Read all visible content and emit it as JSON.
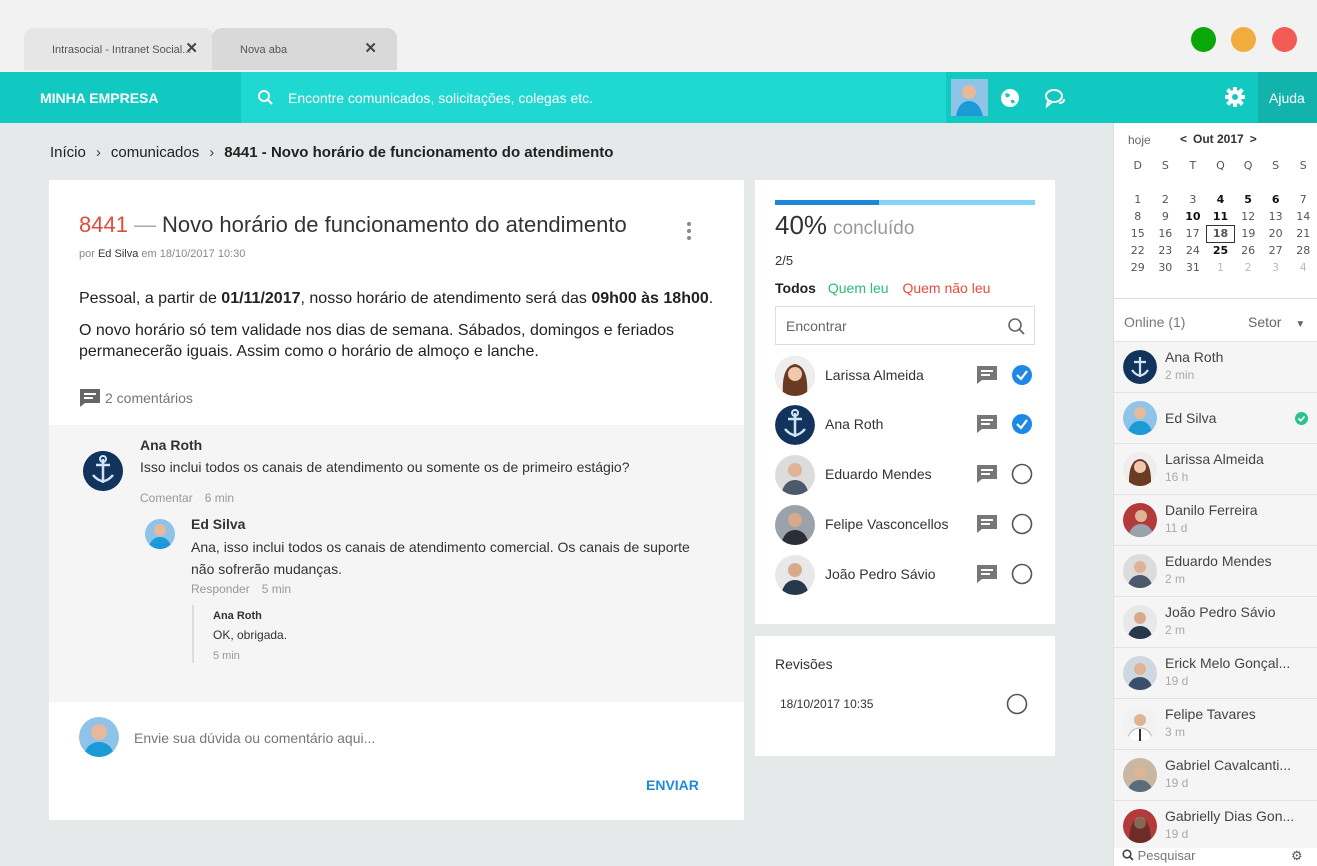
{
  "browser": {
    "tabs": [
      {
        "label": "Intrasocial - Intranet Social..."
      },
      {
        "label": "Nova aba"
      }
    ],
    "window_buttons": [
      "#0aa70a",
      "#f0ad3d",
      "#f25c54"
    ]
  },
  "topbar": {
    "brand": "MINHA EMPRESA",
    "search_placeholder": "Encontre comunicados, solicitações, colegas etc.",
    "help": "Ajuda",
    "accent": "#12c9c1"
  },
  "breadcrumb": {
    "home": "Início",
    "section": "comunicados",
    "current": "8441 - Novo horário de funcionamento do atendimento"
  },
  "post": {
    "number": "8441",
    "dash": "—",
    "title": "Novo horário de funcionamento do atendimento",
    "by_prefix": "por",
    "author": "Ed Silva",
    "date_text": "em 18/10/2017 10:30",
    "p1_a": "Pessoal, a partir de ",
    "p1_date": "01/11/2017",
    "p1_b": ", nosso horário de atendimento será das ",
    "p1_hours": "09h00 às 18h00",
    "p1_c": ".",
    "p2": "O novo horário só tem validade nos dias de semana. Sábados, domingos e feriados permanecerão iguais. Assim como o horário de almoço e lanche.",
    "comment_count": "2 comentários"
  },
  "comments": [
    {
      "name": "Ana Roth",
      "text": "Isso inclui todos os canais de atendimento ou somente os de primeiro estágio?",
      "action": "Comentar",
      "time": "6 min"
    },
    {
      "name": "Ed Silva",
      "text": "Ana, isso inclui todos os canais de atendimento comercial. Os canais de suporte não sofrerão mudanças.",
      "action": "Responder",
      "time": "5 min"
    },
    {
      "name": "Ana Roth",
      "text": "OK, obrigada.",
      "time": "5 min"
    }
  ],
  "compose": {
    "placeholder": "Envie sua dúvida ou comentário aqui...",
    "send": "ENVIAR"
  },
  "reads": {
    "progress": 0.4,
    "percent": "40%",
    "done_label": "concluído",
    "ratio": "2/5",
    "filters": [
      "Todos",
      "Quem leu",
      "Quem não leu"
    ],
    "find_placeholder": "Encontrar",
    "people": [
      {
        "name": "Larissa Almeida",
        "read": true
      },
      {
        "name": "Ana Roth",
        "read": true
      },
      {
        "name": "Eduardo Mendes",
        "read": false
      },
      {
        "name": "Felipe Vasconcellos",
        "read": false
      },
      {
        "name": "João Pedro Sávio",
        "read": false
      }
    ]
  },
  "revisions": {
    "title": "Revisões",
    "items": [
      "18/10/2017 10:35"
    ]
  },
  "calendar": {
    "today": "hoje",
    "month": "Out 2017",
    "weekdays": [
      "D",
      "S",
      "T",
      "Q",
      "Q",
      "S",
      "S"
    ],
    "weeks": [
      [
        "1",
        "2",
        "3",
        "4",
        "5",
        "6",
        "7"
      ],
      [
        "8",
        "9",
        "10",
        "11",
        "12",
        "13",
        "14"
      ],
      [
        "15",
        "16",
        "17",
        "18",
        "19",
        "20",
        "21"
      ],
      [
        "22",
        "23",
        "24",
        "25",
        "26",
        "27",
        "28"
      ],
      [
        "29",
        "30",
        "31",
        "1",
        "2",
        "3",
        "4"
      ]
    ]
  },
  "sidebar": {
    "online": "Online (1)",
    "sector": "Setor",
    "users": [
      {
        "name": "Ana Roth",
        "time": "2 min"
      },
      {
        "name": "Ed Silva",
        "time": ""
      },
      {
        "name": "Larissa Almeida",
        "time": "16 h"
      },
      {
        "name": "Danilo Ferreira",
        "time": "11 d"
      },
      {
        "name": "Eduardo Mendes",
        "time": "2 m"
      },
      {
        "name": "João Pedro Sávio",
        "time": "2 m"
      },
      {
        "name": "Erick Melo Gonçal...",
        "time": "19 d"
      },
      {
        "name": "Felipe Tavares",
        "time": "3 m"
      },
      {
        "name": "Gabriel Cavalcanti...",
        "time": "19 d"
      },
      {
        "name": "Gabrielly Dias Gon...",
        "time": "19 d"
      }
    ],
    "search": "Pesquisar"
  }
}
